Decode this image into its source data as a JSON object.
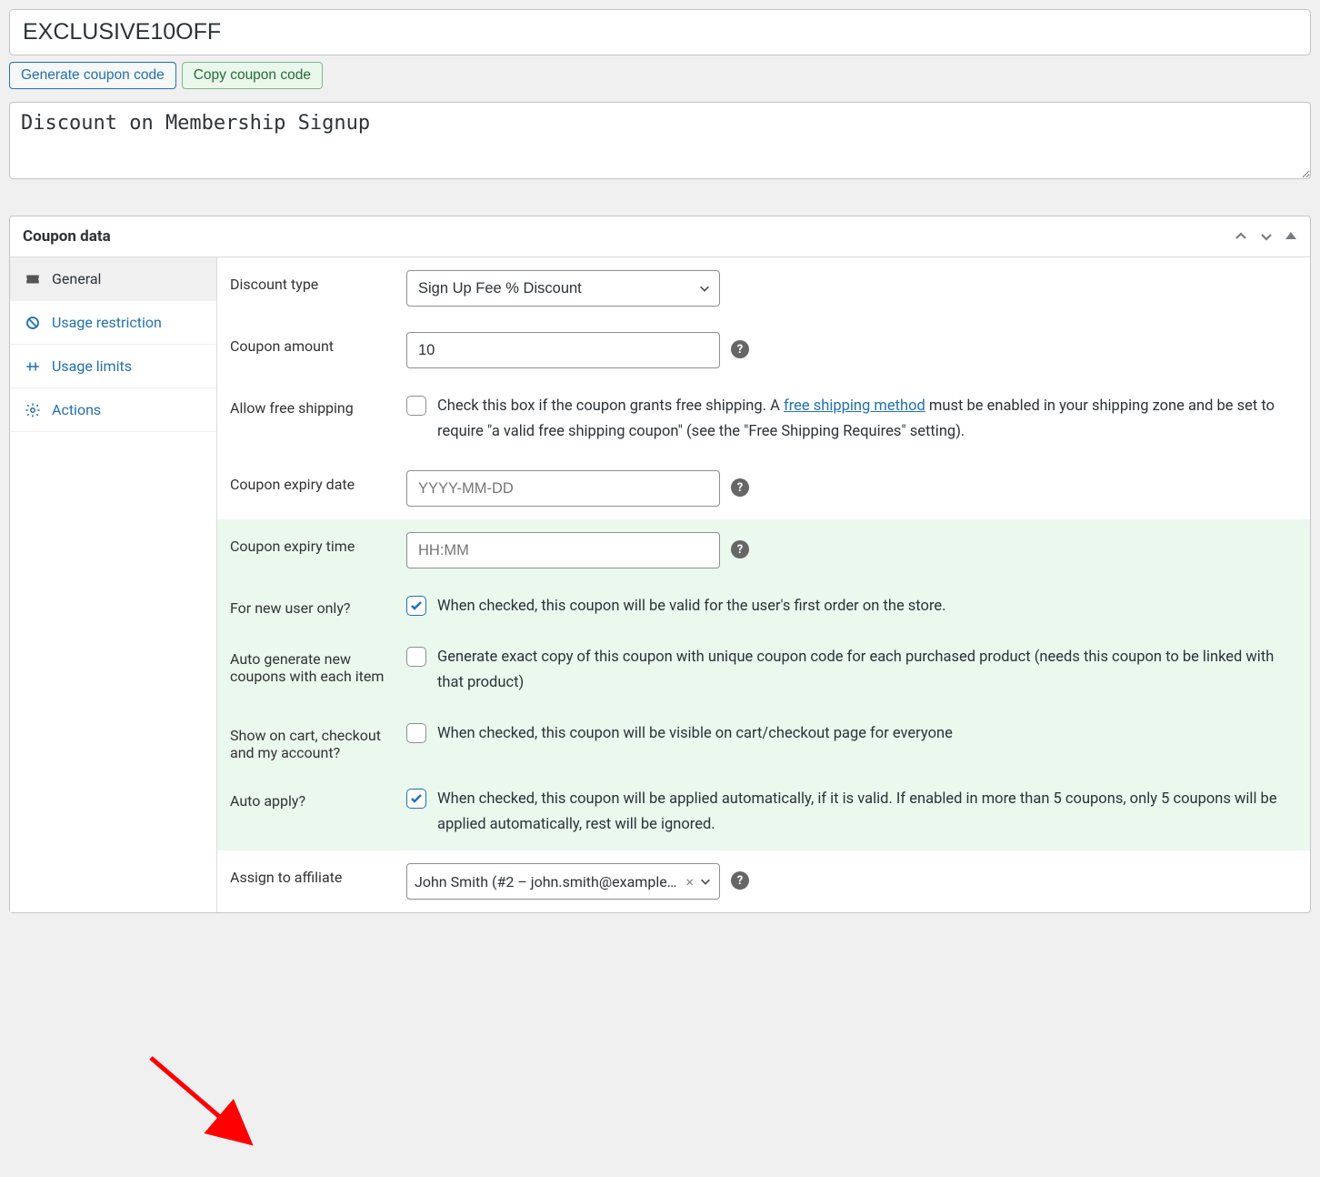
{
  "coupon": {
    "code": "EXCLUSIVE10OFF",
    "description": "Discount on Membership Signup"
  },
  "buttons": {
    "generate": "Generate coupon code",
    "copy": "Copy coupon code"
  },
  "panel": {
    "title": "Coupon data"
  },
  "sidebar": {
    "items": [
      {
        "label": "General"
      },
      {
        "label": "Usage restriction"
      },
      {
        "label": "Usage limits"
      },
      {
        "label": "Actions"
      }
    ]
  },
  "fields": {
    "discountType": {
      "label": "Discount type",
      "value": "Sign Up Fee % Discount"
    },
    "couponAmount": {
      "label": "Coupon amount",
      "value": "10"
    },
    "freeShipping": {
      "label": "Allow free shipping",
      "text_before": "Check this box if the coupon grants free shipping. A ",
      "link": "free shipping method",
      "text_after": " must be enabled in your shipping zone and be set to require \"a valid free shipping coupon\" (see the \"Free Shipping Requires\" setting)."
    },
    "expiryDate": {
      "label": "Coupon expiry date",
      "placeholder": "YYYY-MM-DD"
    },
    "expiryTime": {
      "label": "Coupon expiry time",
      "placeholder": "HH:MM"
    },
    "newUser": {
      "label": "For new user only?",
      "text": "When checked, this coupon will be valid for the user's first order on the store."
    },
    "autoGenerate": {
      "label": "Auto generate new coupons with each item",
      "text": "Generate exact copy of this coupon with unique coupon code for each purchased product (needs this coupon to be linked with that product)"
    },
    "showOnCart": {
      "label": "Show on cart, checkout and my account?",
      "text": "When checked, this coupon will be visible on cart/checkout page for everyone"
    },
    "autoApply": {
      "label": "Auto apply?",
      "text": "When checked, this coupon will be applied automatically, if it is valid. If enabled in more than 5 coupons, only 5 coupons will be applied automatically, rest will be ignored."
    },
    "affiliate": {
      "label": "Assign to affiliate",
      "value": "John Smith (#2 – john.smith@example.com)"
    }
  }
}
